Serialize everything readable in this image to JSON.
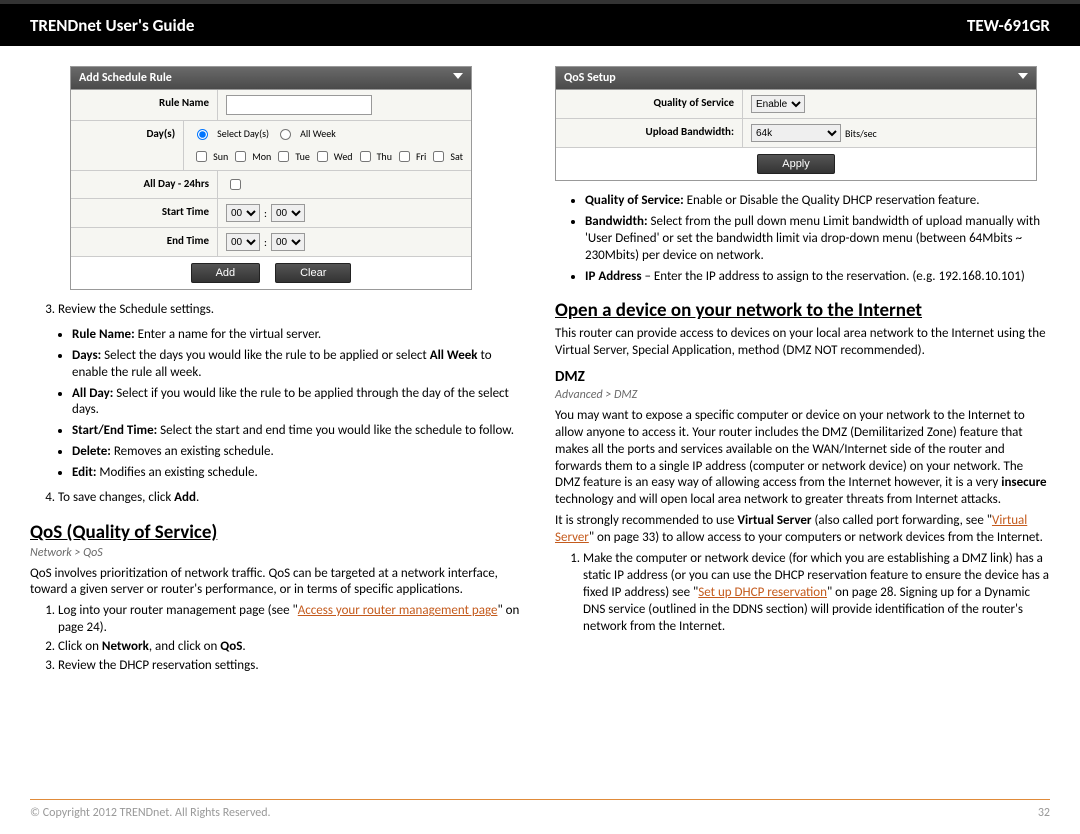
{
  "header": {
    "left": "TRENDnet User's Guide",
    "right": "TEW-691GR"
  },
  "left_col": {
    "schedule_box": {
      "title": "Add Schedule Rule",
      "rule_name_label": "Rule Name",
      "days_label": "Day(s)",
      "select_days": "Select Day(s)",
      "all_week": "All Week",
      "days": [
        "Sun",
        "Mon",
        "Tue",
        "Wed",
        "Thu",
        "Fri",
        "Sat"
      ],
      "all_day_label": "All Day - 24hrs",
      "start_time_label": "Start Time",
      "end_time_label": "End Time",
      "time_hours": "00",
      "time_minutes": "00",
      "add_btn": "Add",
      "clear_btn": "Clear"
    },
    "step3": "Review the Schedule settings.",
    "bullets": [
      {
        "bold": "Rule Name:",
        "text": " Enter a name for the virtual server."
      },
      {
        "bold": "Days:",
        "text": " Select the days you would like the rule to be applied or select ",
        "bold2": "All Week",
        "text2": " to enable the rule all week."
      },
      {
        "bold": "All Day:",
        "text": " Select if you would like the rule to be applied through the day of the select days."
      },
      {
        "bold": "Start/End Time:",
        "text": " Select the start and end time you would like the schedule to follow."
      },
      {
        "bold": "Delete:",
        "text": " Removes an existing schedule."
      },
      {
        "bold": "Edit:",
        "text": " Modifies an existing schedule."
      }
    ],
    "step4_pre": "To save changes, click ",
    "step4_bold": "Add",
    "step4_post": ".",
    "qos_heading": "QoS (Quality of Service)",
    "qos_breadcrumb": "Network > QoS",
    "qos_desc": "QoS involves prioritization of network traffic. QoS can be targeted at a network interface, toward a given server or router's performance, or in terms of specific applications.",
    "qos_step1_pre": "Log into your router management page (see \"",
    "qos_step1_link": "Access your router management page",
    "qos_step1_post": "\" on page 24).",
    "qos_step2_pre": "Click on ",
    "qos_step2_b1": "Network",
    "qos_step2_mid": ", and click on ",
    "qos_step2_b2": "QoS",
    "qos_step2_post": ".",
    "qos_step3": "Review the DHCP reservation settings."
  },
  "right_col": {
    "qos_box": {
      "title": "QoS Setup",
      "qos_label": "Quality of Service",
      "qos_value": "Enable",
      "bw_label": "Upload Bandwidth:",
      "bw_value": "64k",
      "bw_unit": "Bits/sec",
      "apply_btn": "Apply"
    },
    "qos_bullets": [
      {
        "bold": "Quality of Service:",
        "text": " Enable or Disable the Quality DHCP reservation feature."
      },
      {
        "bold": "Bandwidth:",
        "text": " Select from the pull down menu Limit bandwidth of upload manually with 'User Defined' or set the bandwidth limit via drop-down menu (between 64Mbits ~ 230Mbits) per device on network."
      },
      {
        "bold": "IP Address",
        "text": " – Enter the IP address to assign to the reservation. (e.g. 192.168.10.101)"
      }
    ],
    "open_heading": "Open a device on your network to the Internet",
    "open_desc": "This router can provide access to devices on your local area network to the Internet using the Virtual Server, Special Application, method (DMZ NOT recommended).",
    "dmz_heading": "DMZ",
    "dmz_breadcrumb": "Advanced > DMZ",
    "dmz_p1_pre": "You may want to expose a specific computer or device on your network to the Internet to allow anyone to access it. Your router includes the DMZ (Demilitarized Zone) feature that makes all the ports and services available on the WAN/Internet side of the router and forwards them to a single IP address (computer or network device) on your network. The DMZ feature is an easy way of allowing access from the Internet however, it is a very ",
    "dmz_p1_bold": "insecure",
    "dmz_p1_post": " technology and will open local area network to greater threats from Internet attacks.",
    "dmz_p2_pre": "It is strongly recommended to use ",
    "dmz_p2_bold": "Virtual Server",
    "dmz_p2_mid": " (also called port forwarding, see \"",
    "dmz_p2_link": "Virtual Server",
    "dmz_p2_post": "\" on page 33) to allow access to your computers or network devices from the Internet.",
    "dmz_step1_pre": "Make the computer or network device (for which you are establishing a DMZ link) has a static IP address (or you can use the DHCP reservation feature to ensure the device has a fixed IP address) see \"",
    "dmz_step1_link": "Set up DHCP reservation",
    "dmz_step1_post": "\" on page 28. Signing up for a Dynamic DNS service (outlined in the DDNS section) will provide identification of the router's network from the Internet."
  },
  "footer": {
    "copyright": "© Copyright 2012 TRENDnet. All Rights Reserved.",
    "page": "32"
  }
}
